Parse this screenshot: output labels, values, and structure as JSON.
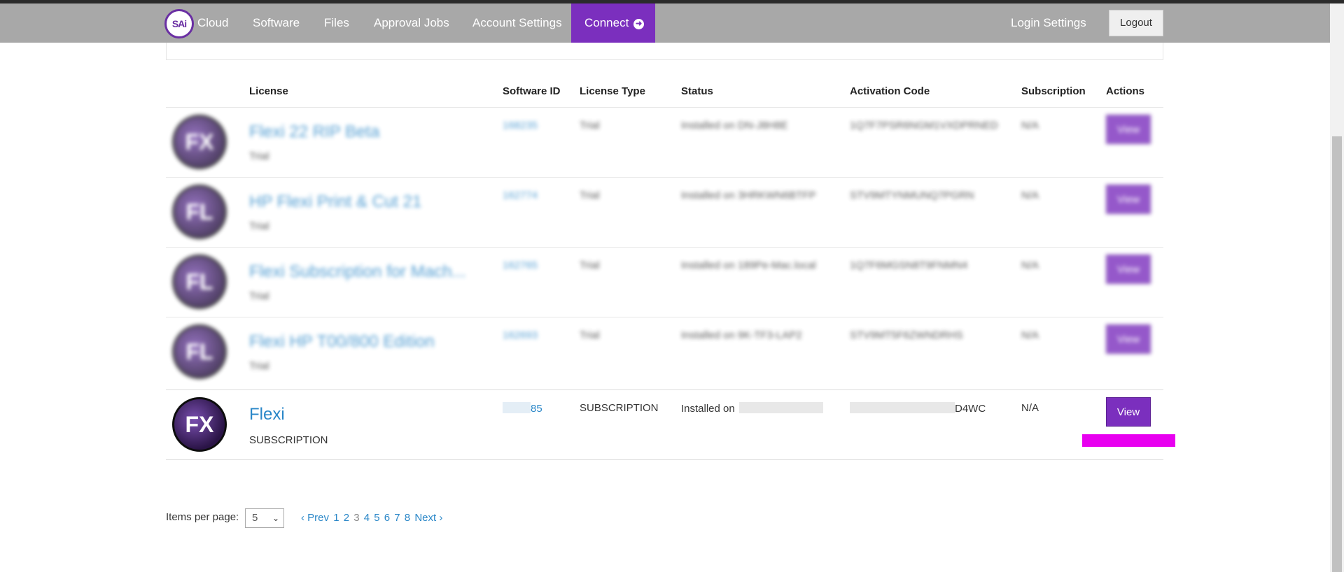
{
  "nav": {
    "logo_text": "SAi",
    "items": [
      "Cloud",
      "Software",
      "Files",
      "Approval Jobs",
      "Account Settings"
    ],
    "connect_label": "Connect",
    "login_settings": "Login Settings",
    "logout": "Logout"
  },
  "table": {
    "headers": [
      "License",
      "Software ID",
      "License Type",
      "Status",
      "Activation Code",
      "Subscription",
      "Actions"
    ],
    "blurred_rows": [
      {
        "avatar": "FX",
        "name": "Flexi 22 RIP Beta",
        "sub": "Trial",
        "software_id": "168235",
        "type": "Trial",
        "status": "Installed on DN-J8H8E",
        "activation": "1Q7F7PSR6NGM1VXDPRNED",
        "subscription": "N/A",
        "action": "View"
      },
      {
        "avatar": "FL",
        "name": "HP Flexi Print & Cut 21",
        "sub": "Trial",
        "software_id": "162774",
        "type": "Trial",
        "status": "Installed on 3HRKWN6BTFP",
        "activation": "STV9MTYNMUNQ7PGRN",
        "subscription": "N/A",
        "action": "View"
      },
      {
        "avatar": "FL",
        "name": "Flexi Subscription for Mach...",
        "sub": "Trial",
        "software_id": "162765",
        "type": "Trial",
        "status": "Installed on 189Pe-Mac.local",
        "activation": "1Q7F6MGSN8T9FNMN4",
        "subscription": "N/A",
        "action": "View"
      },
      {
        "avatar": "FL",
        "name": "Flexi HP T00/800 Edition",
        "sub": "Trial",
        "software_id": "162693",
        "type": "Trial",
        "status": "Installed on 9K-TF3-LAP2",
        "activation": "STV9MT5F6ZWNDRHS",
        "subscription": "N/A",
        "action": "View"
      }
    ],
    "active_row": {
      "avatar": "FX",
      "name": "Flexi",
      "sub": "SUBSCRIPTION",
      "software_id_suffix": "85",
      "type": "SUBSCRIPTION",
      "status_prefix": "Installed on",
      "activation_suffix": "D4WC",
      "subscription": "N/A",
      "action": "View"
    }
  },
  "pagination": {
    "items_per_page_label": "Items per page:",
    "items_per_page_value": "5",
    "prev": "‹ Prev",
    "pages": [
      "1",
      "2",
      "3",
      "4",
      "5",
      "6",
      "7",
      "8"
    ],
    "current_page": "3",
    "next": "Next ›"
  },
  "colors": {
    "nav_bg": "#a8a8a8",
    "accent": "#7b2fbe",
    "link": "#2a87c8",
    "highlight": "#e800f0"
  }
}
